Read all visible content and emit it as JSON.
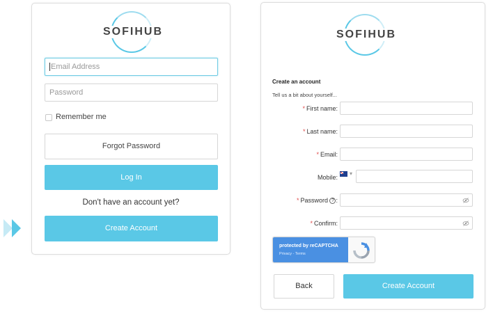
{
  "login": {
    "brand": "SOFIHUB",
    "email_placeholder": "Email Address",
    "password_placeholder": "Password",
    "remember_label": "Remember me",
    "forgot_label": "Forgot Password",
    "login_label": "Log In",
    "no_account_text": "Don't have an account yet?",
    "create_label": "Create Account"
  },
  "signup": {
    "brand": "SOFIHUB",
    "heading": "Create an account",
    "subheading": "Tell us a bit about yourself...",
    "required_marker": "*",
    "fields": {
      "first_name": "First name:",
      "last_name": "Last name:",
      "email": "Email:",
      "mobile": "Mobile:",
      "password": "Password",
      "password_help": "?",
      "password_colon": ":",
      "confirm": "Confirm:"
    },
    "mobile_country": "Australia",
    "recaptcha_text": "protected by reCAPTCHA",
    "recaptcha_links": "Privacy - Terms",
    "back_label": "Back",
    "create_label": "Create Account"
  },
  "colors": {
    "accent": "#5ac8e6",
    "required": "#e04b4b",
    "recaptcha_blue": "#4a90e2"
  }
}
